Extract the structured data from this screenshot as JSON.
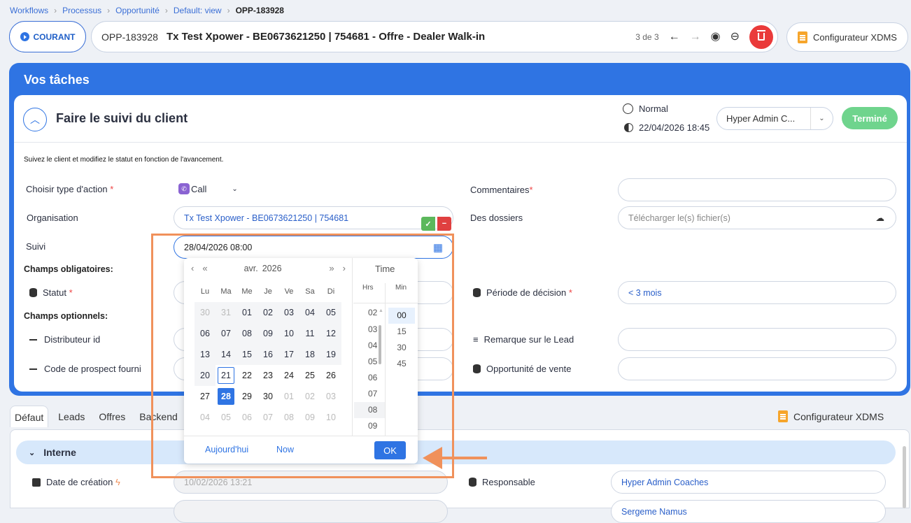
{
  "breadcrumb": {
    "items": [
      "Workflows",
      "Processus",
      "Opportunité",
      "Default: view"
    ],
    "current": "OPP-183928"
  },
  "header": {
    "courant_label": "COURANT",
    "record_id": "OPP-183928",
    "record_title": "Tx Test Xpower - BE0673621250 | 754681 - Offre - Dealer Walk-in",
    "counter": "3 de 3",
    "config_label": "Configurateur XDMS"
  },
  "panel": {
    "title": "Vos tâches"
  },
  "task": {
    "title": "Faire le suivi du client",
    "priority": "Normal",
    "due": "22/04/2026 18:45",
    "assignee": "Hyper Admin C...",
    "done_label": "Terminé",
    "description": "Suivez le client et modifiez le statut en fonction de l'avancement."
  },
  "form": {
    "action_label": "Choisir type d'action",
    "action_value": "Call",
    "org_label": "Organisation",
    "org_value": "Tx Test Xpower - BE0673621250 | 754681",
    "suivi_label": "Suivi",
    "suivi_value": "28/04/2026 08:00",
    "mandatory_header": "Champs obligatoires:",
    "statut_label": "Statut",
    "optional_header": "Champs optionnels:",
    "distrib_label": "Distributeur id",
    "prospect_label": "Code de prospect fourni",
    "comments_label": "Commentaires",
    "dossiers_label": "Des dossiers",
    "dossiers_placeholder": "Télécharger le(s) fichier(s)",
    "periode_label": "Période de décision",
    "periode_value": "< 3 mois",
    "remarque_label": "Remarque sur le Lead",
    "opportunite_label": "Opportunité de vente"
  },
  "calendar": {
    "month": "avr.",
    "year": "2026",
    "time_label": "Time",
    "hrs_label": "Hrs",
    "min_label": "Min",
    "weekdays": [
      "Lu",
      "Ma",
      "Me",
      "Je",
      "Ve",
      "Sa",
      "Di"
    ],
    "hours": [
      "02",
      "03",
      "04",
      "05",
      "06",
      "07",
      "08",
      "09"
    ],
    "minutes": [
      "00",
      "15",
      "30",
      "45"
    ],
    "today_link": "Aujourd'hui",
    "now_link": "Now",
    "ok_label": "OK"
  },
  "tabs": [
    "Défaut",
    "Leads",
    "Offres",
    "Backend"
  ],
  "bottom": {
    "config_label": "Configurateur XDMS",
    "section": "Interne",
    "creation_label": "Date de création",
    "creation_value": "10/02/2026 13:21",
    "responsable_label": "Responsable",
    "responsable_value": "Hyper Admin Coaches",
    "partial_value": "Sergeme Namus"
  }
}
